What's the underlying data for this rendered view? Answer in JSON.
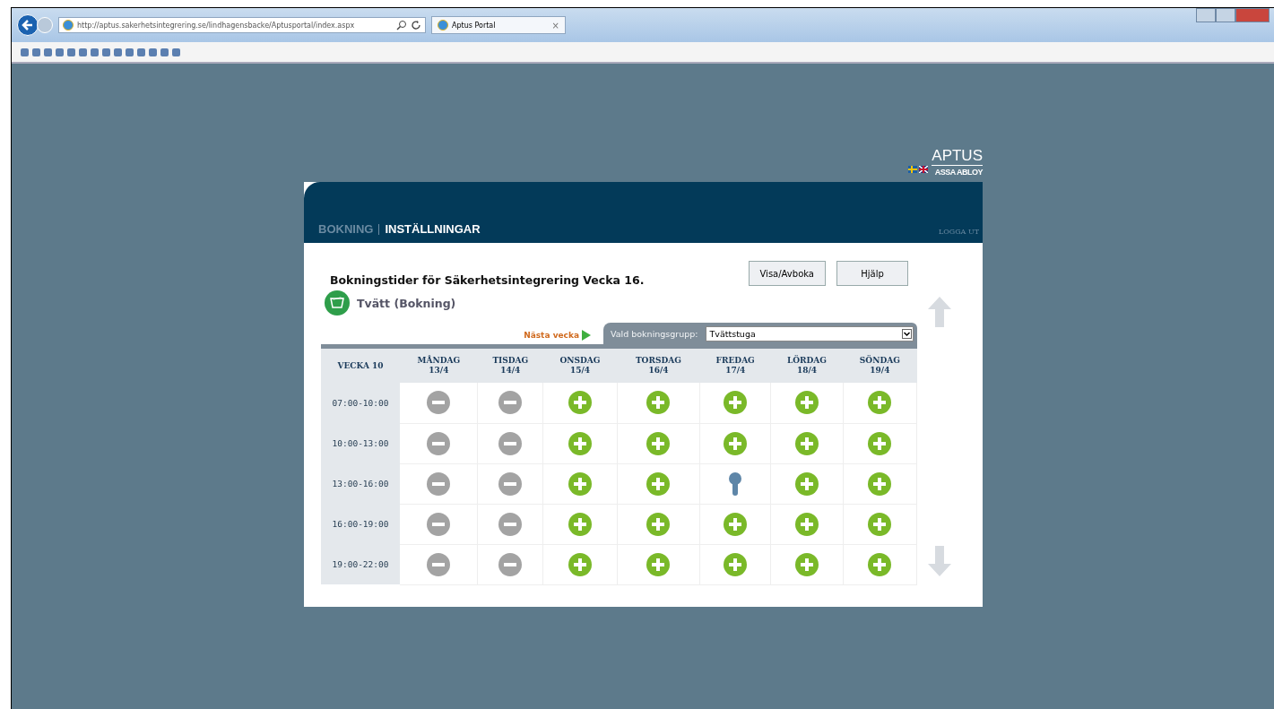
{
  "browser": {
    "address": "http://aptus.sakerhetsintegrering.se/lindhagensbacke/Aptusportal/index.aspx",
    "tab": {
      "title": "Aptus Portal",
      "close": "×"
    }
  },
  "logo": {
    "brand": "APTUS",
    "parent": "ASSA ABLOY"
  },
  "nav": {
    "items": [
      {
        "label": "BOKNING",
        "selected": false
      },
      {
        "label": "INSTÄLLNINGAR",
        "selected": true
      }
    ],
    "logout": "LOGGA UT"
  },
  "heading": "Bokningstider för Säkerhetsintegrering Vecka 16.",
  "buttons": [
    "Visa/Avboka",
    "Hjälp"
  ],
  "resource": "Tvätt (Bokning)",
  "next_week": "Nästa vecka",
  "group": {
    "label": "Vald bokningsgrupp:",
    "value": "Tvättstuga"
  },
  "table": {
    "week": "VECKA 10",
    "days": [
      {
        "name": "MÅNDAG",
        "date": "13/4"
      },
      {
        "name": "TISDAG",
        "date": "14/4"
      },
      {
        "name": "ONSDAG",
        "date": "15/4"
      },
      {
        "name": "TORSDAG",
        "date": "16/4"
      },
      {
        "name": "FREDAG",
        "date": "17/4"
      },
      {
        "name": "LÖRDAG",
        "date": "18/4"
      },
      {
        "name": "SÖNDAG",
        "date": "19/4"
      }
    ],
    "rows": [
      {
        "time": "07:00-10:00",
        "slots": [
          {
            "kind": "unavailable"
          },
          {
            "kind": "unavailable"
          },
          {
            "kind": "free"
          },
          {
            "kind": "free"
          },
          {
            "kind": "free"
          },
          {
            "kind": "free"
          },
          {
            "kind": "free"
          }
        ]
      },
      {
        "time": "10:00-13:00",
        "slots": [
          {
            "kind": "unavailable"
          },
          {
            "kind": "unavailable"
          },
          {
            "kind": "free"
          },
          {
            "kind": "free"
          },
          {
            "kind": "free"
          },
          {
            "kind": "free"
          },
          {
            "kind": "free"
          }
        ]
      },
      {
        "time": "13:00-16:00",
        "slots": [
          {
            "kind": "unavailable"
          },
          {
            "kind": "unavailable"
          },
          {
            "kind": "free"
          },
          {
            "kind": "free"
          },
          {
            "kind": "booked"
          },
          {
            "kind": "free"
          },
          {
            "kind": "free"
          }
        ]
      },
      {
        "time": "16:00-19:00",
        "slots": [
          {
            "kind": "unavailable"
          },
          {
            "kind": "unavailable"
          },
          {
            "kind": "free"
          },
          {
            "kind": "free"
          },
          {
            "kind": "free"
          },
          {
            "kind": "free"
          },
          {
            "kind": "free"
          }
        ]
      },
      {
        "time": "19:00-22:00",
        "slots": [
          {
            "kind": "unavailable"
          },
          {
            "kind": "unavailable"
          },
          {
            "kind": "free"
          },
          {
            "kind": "free"
          },
          {
            "kind": "free"
          },
          {
            "kind": "free"
          },
          {
            "kind": "free"
          }
        ]
      }
    ]
  }
}
